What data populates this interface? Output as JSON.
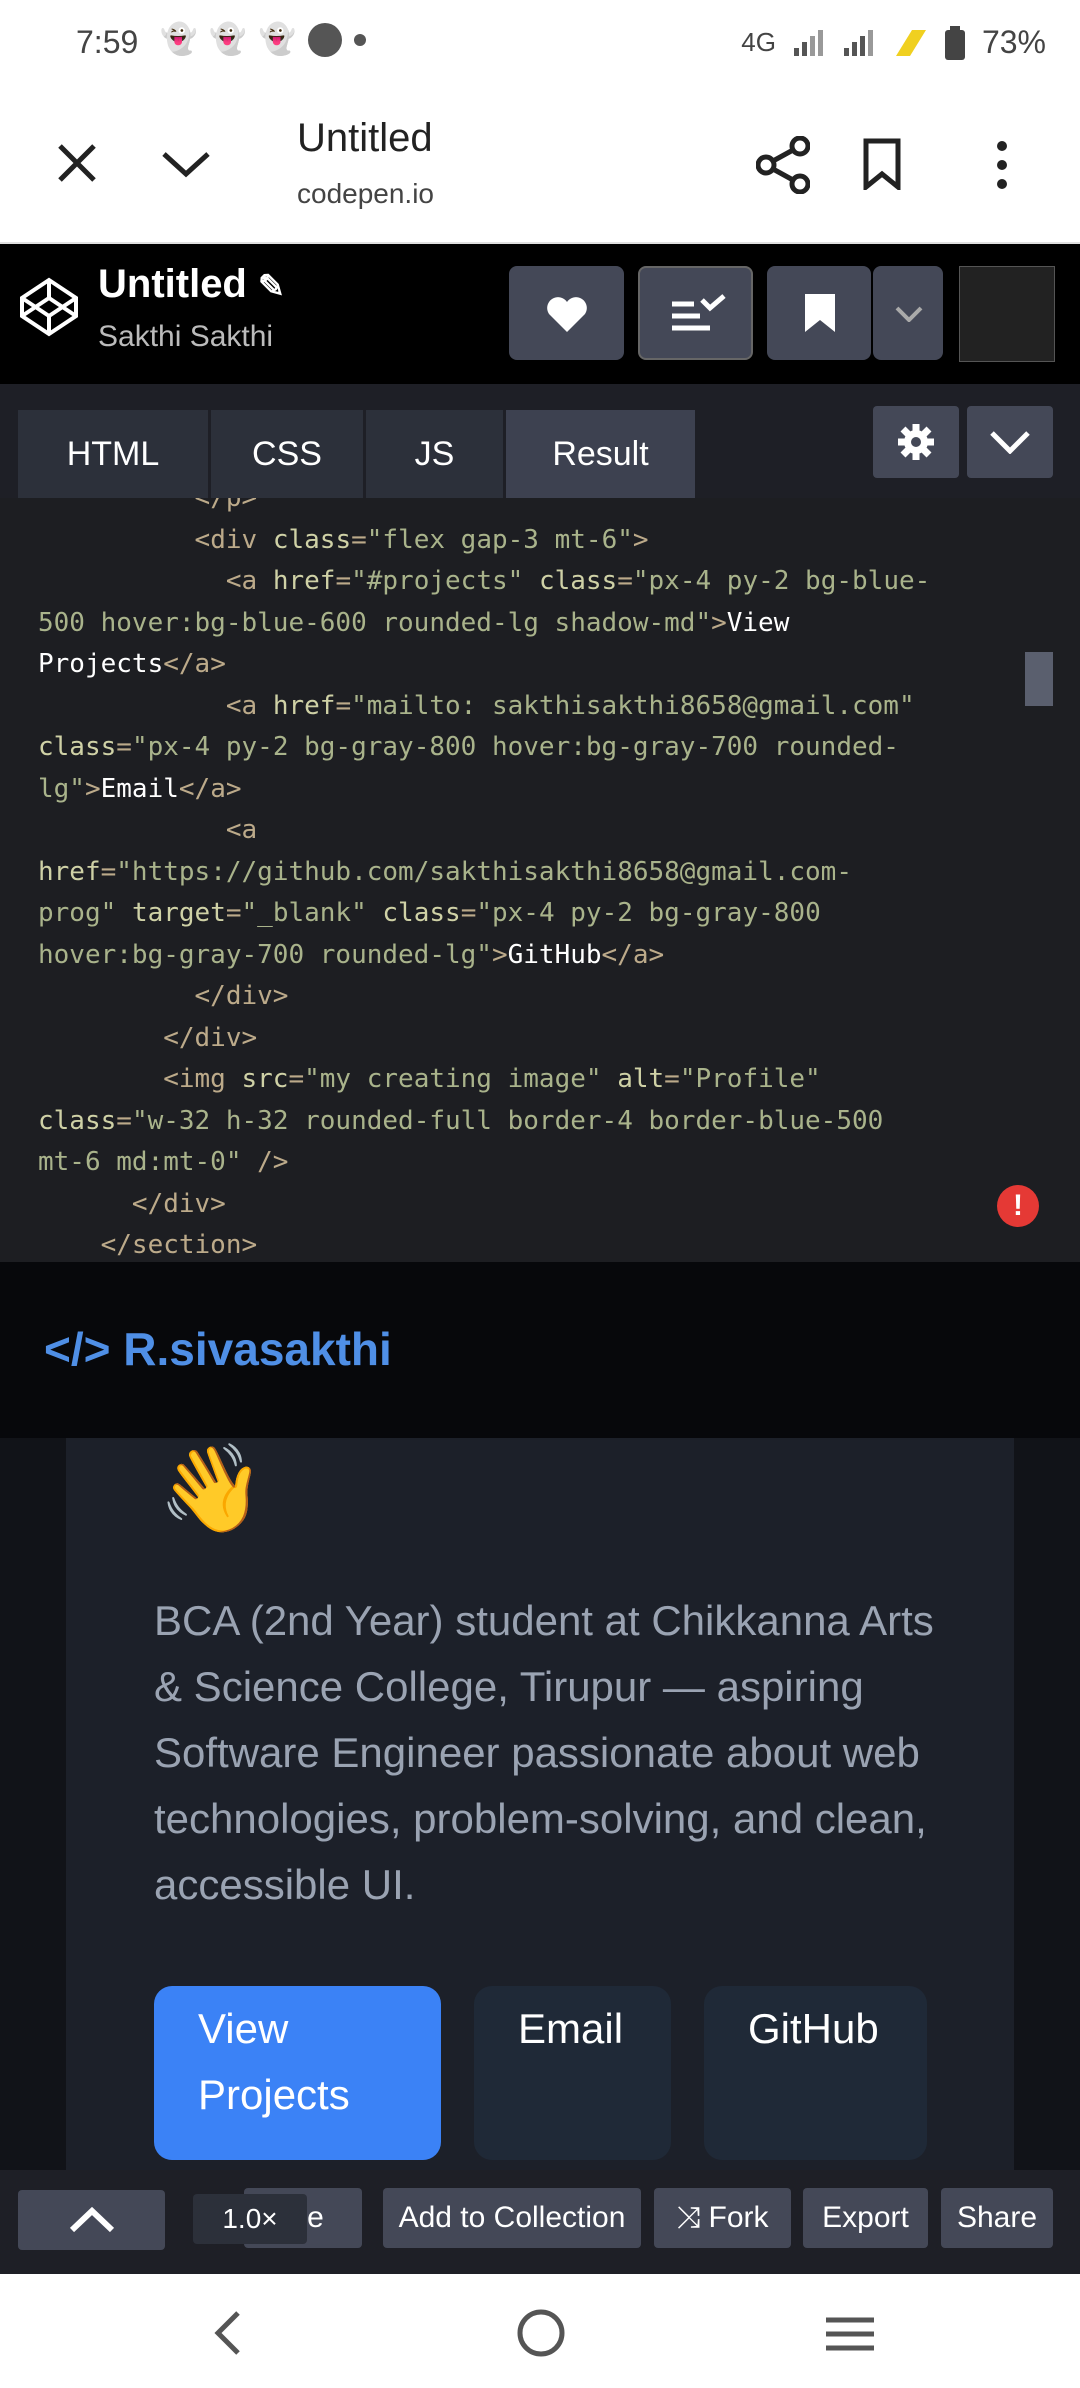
{
  "status_bar": {
    "time": "7:59",
    "network": "4G",
    "battery": "73%"
  },
  "browser": {
    "title": "Untitled",
    "url": "codepen.io"
  },
  "pen": {
    "title": "Untitled",
    "author": "Sakthi Sakthi"
  },
  "tabs": [
    "HTML",
    "CSS",
    "JS",
    "Result"
  ],
  "code": {
    "line1": "</p>",
    "line2_tag": "<div",
    "line2_attr": "class",
    "line2_val": "\"flex gap-3 mt-6\"",
    "a1_attr_href": "href",
    "a1_href": "\"#projects\"",
    "a1_class_val": "\"px-4 py-2 bg-blue-",
    "a1_class_val2": "500 hover:bg-blue-600 rounded-lg shadow-md\"",
    "a1_text1": "View",
    "a1_text2": "Projects",
    "a2_href": "\"mailto: sakthisakthi8658@gmail.com\"",
    "a2_class_val": "\"px-4 py-2 bg-gray-800 hover:bg-gray-700 rounded-",
    "a2_class_val2": "lg\"",
    "a2_text": "Email",
    "a3_href": "\"https://github.com/sakthisakthi8658@gmail.com-",
    "a3_href2": "prog\"",
    "a3_target": "\"_blank\"",
    "a3_class_val": "\"px-4 py-2 bg-gray-800",
    "a3_class_val2": "hover:bg-gray-700 rounded-lg\"",
    "a3_text": "GitHub",
    "img_src": "\"my creating image\"",
    "img_alt": "\"Profile\"",
    "img_class": "\"w-32 h-32 rounded-full border-4 border-blue-500",
    "img_class2": "mt-6 md:mt-0\""
  },
  "preview": {
    "brand": "</> R.sivasakthi",
    "wave": "👋",
    "bio": "BCA (2nd Year) student at Chikkanna Arts & Science College, Tirupur — aspiring Software Engineer passionate about web technologies, problem-solving, and clean, accessible UI.",
    "buttons": [
      "View Projects",
      "Email",
      "GitHub"
    ],
    "colors": {
      "primary": "#3b82f6",
      "secondary": "#1f2937",
      "brand": "#4f8fe6"
    }
  },
  "toolbar": {
    "zoom": "1.0×",
    "delete_partial": "ete",
    "add_to_collection": "Add to Collection",
    "fork": "Fork",
    "export": "Export",
    "share": "Share"
  }
}
